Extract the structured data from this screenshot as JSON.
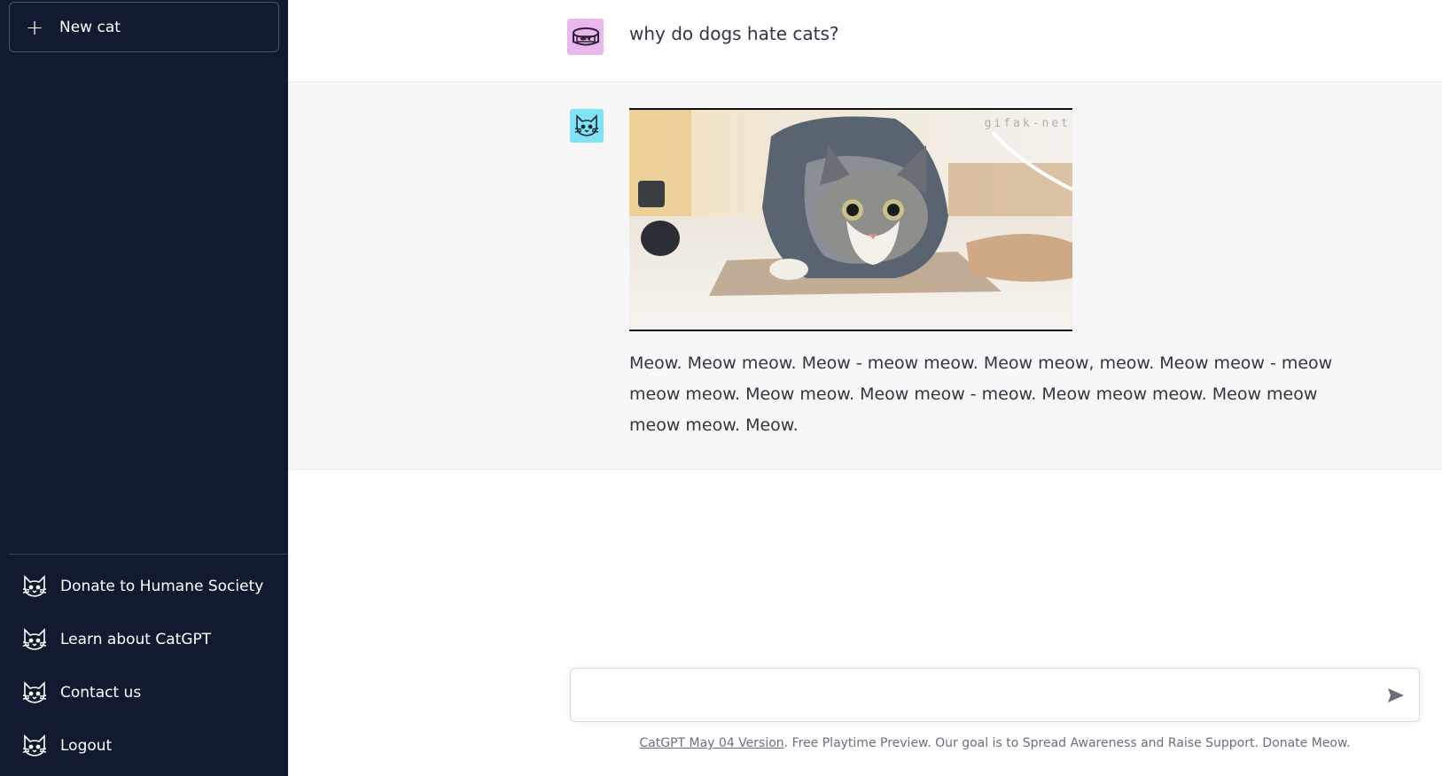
{
  "sidebar": {
    "new_chat_label": "New cat",
    "items": [
      {
        "label": "Donate to Humane Society",
        "icon": "cat-icon"
      },
      {
        "label": "Learn about CatGPT",
        "icon": "cat-icon"
      },
      {
        "label": "Contact us",
        "icon": "cat-icon"
      },
      {
        "label": "Logout",
        "icon": "cat-icon"
      }
    ]
  },
  "conversation": {
    "user_message": "why do dogs hate cats?",
    "bot_image_watermark": "gifak-net",
    "bot_message": "Meow. Meow meow. Meow - meow meow. Meow meow, meow. Meow meow - meow meow meow. Meow meow. Meow meow - meow. Meow meow meow. Meow meow meow meow. Meow."
  },
  "composer": {
    "placeholder": "",
    "value": ""
  },
  "footer": {
    "version_link": "CatGPT May 04 Version",
    "note": ". Free Playtime Preview. Our goal is to Spread Awareness and Raise Support. Donate Meow."
  },
  "colors": {
    "sidebar_bg": "#111a2e",
    "user_avatar_bg": "#e9b6ee",
    "bot_avatar_bg": "#7fe3f3",
    "bot_row_bg": "#f7f7f8"
  }
}
